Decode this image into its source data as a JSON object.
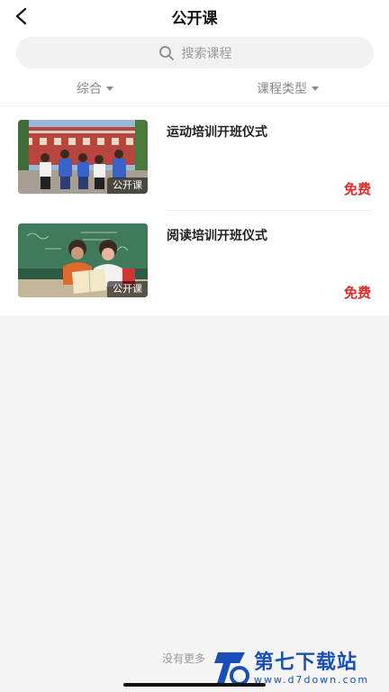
{
  "header": {
    "title": "公开课",
    "back_icon": "chevron-left-icon"
  },
  "search": {
    "placeholder": "搜索课程",
    "icon": "search-icon"
  },
  "filters": [
    {
      "label": "综合",
      "icon": "caret-down-icon"
    },
    {
      "label": "课程类型",
      "icon": "caret-down-icon"
    }
  ],
  "courses": [
    {
      "title": "运动培训开班仪式",
      "badge": "公开课",
      "price": "免费"
    },
    {
      "title": "阅读培训开班仪式",
      "badge": "公开课",
      "price": "免费"
    }
  ],
  "footer": {
    "text": "没有更多"
  },
  "watermark": {
    "name": "第七下载站",
    "url": "www.d7down.com"
  },
  "colors": {
    "price": "#e02b2b",
    "accent": "#1a4fb5"
  }
}
